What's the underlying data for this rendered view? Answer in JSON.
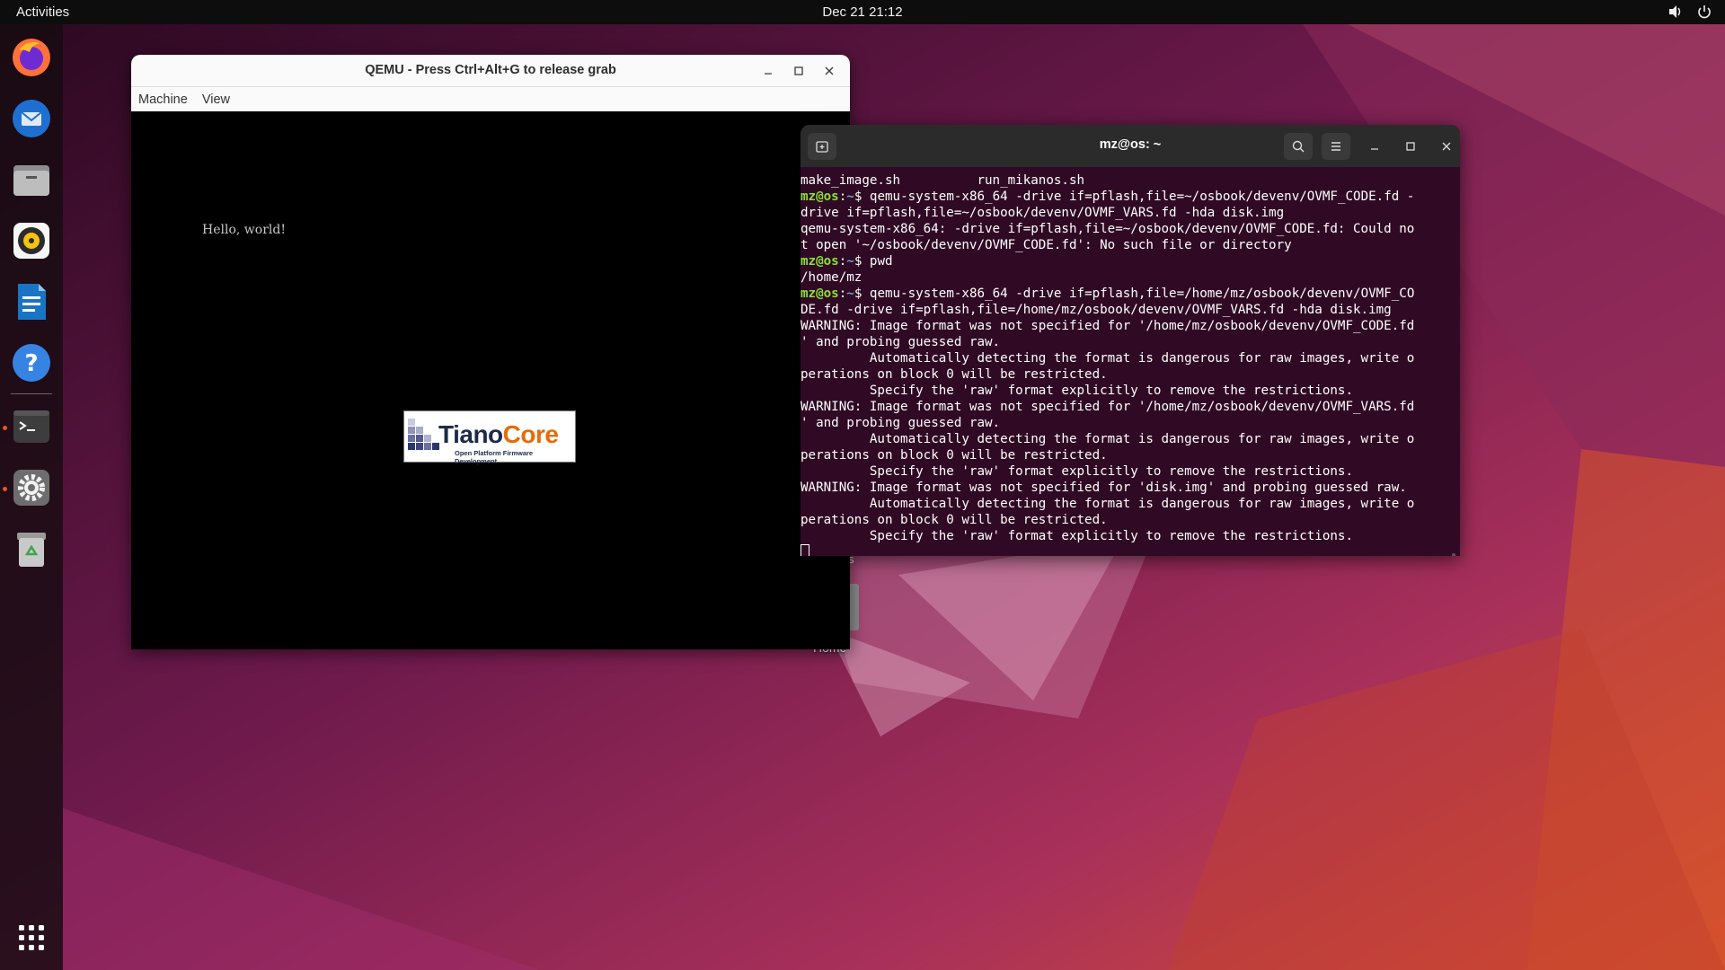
{
  "topbar": {
    "activities_label": "Activities",
    "clock": "Dec 21  21:12",
    "tray_icons": [
      "volume-icon",
      "power-icon"
    ]
  },
  "dock": {
    "apps": [
      {
        "name": "firefox-icon",
        "running": false
      },
      {
        "name": "thunderbird-icon",
        "running": false
      },
      {
        "name": "files-icon",
        "running": false
      },
      {
        "name": "rhythmbox-icon",
        "running": false
      },
      {
        "name": "libreoffice-writer-icon",
        "running": false
      },
      {
        "name": "help-icon",
        "running": false
      },
      {
        "name": "terminal-icon",
        "running": true
      },
      {
        "name": "settings-icon",
        "running": true
      },
      {
        "name": "trash-icon",
        "running": false
      }
    ],
    "show_apps_icon": "app-grid-icon",
    "accent": "#e95420"
  },
  "desktop": {
    "home_label": "Home",
    "partial_label": "s"
  },
  "qemu": {
    "title": "QEMU - Press Ctrl+Alt+G to release grab",
    "menu": [
      "Machine",
      "View"
    ],
    "screen_text": "Hello, world!",
    "logo_main": "Tiano",
    "logo_accent": "Core",
    "logo_sub": "Open Platform Firmware Development"
  },
  "terminal": {
    "title": "mz@os: ~",
    "prompt_user": "mz@os",
    "prompt_path": "~",
    "lines": [
      {
        "type": "out",
        "text": "make_image.sh          run_mikanos.sh"
      },
      {
        "type": "cmd",
        "text": "qemu-system-x86_64 -drive if=pflash,file=~/osbook/devenv/OVMF_CODE.fd -"
      },
      {
        "type": "out",
        "text": "drive if=pflash,file=~/osbook/devenv/OVMF_VARS.fd -hda disk.img"
      },
      {
        "type": "out",
        "text": "qemu-system-x86_64: -drive if=pflash,file=~/osbook/devenv/OVMF_CODE.fd: Could no"
      },
      {
        "type": "out",
        "text": "t open '~/osbook/devenv/OVMF_CODE.fd': No such file or directory"
      },
      {
        "type": "cmd",
        "text": "pwd"
      },
      {
        "type": "out",
        "text": "/home/mz"
      },
      {
        "type": "cmd",
        "text": "qemu-system-x86_64 -drive if=pflash,file=/home/mz/osbook/devenv/OVMF_CO"
      },
      {
        "type": "out",
        "text": "DE.fd -drive if=pflash,file=/home/mz/osbook/devenv/OVMF_VARS.fd -hda disk.img"
      },
      {
        "type": "out",
        "text": "WARNING: Image format was not specified for '/home/mz/osbook/devenv/OVMF_CODE.fd"
      },
      {
        "type": "out",
        "text": "' and probing guessed raw."
      },
      {
        "type": "out",
        "text": "         Automatically detecting the format is dangerous for raw images, write o"
      },
      {
        "type": "out",
        "text": "perations on block 0 will be restricted."
      },
      {
        "type": "out",
        "text": "         Specify the 'raw' format explicitly to remove the restrictions."
      },
      {
        "type": "out",
        "text": "WARNING: Image format was not specified for '/home/mz/osbook/devenv/OVMF_VARS.fd"
      },
      {
        "type": "out",
        "text": "' and probing guessed raw."
      },
      {
        "type": "out",
        "text": "         Automatically detecting the format is dangerous for raw images, write o"
      },
      {
        "type": "out",
        "text": "perations on block 0 will be restricted."
      },
      {
        "type": "out",
        "text": "         Specify the 'raw' format explicitly to remove the restrictions."
      },
      {
        "type": "out",
        "text": "WARNING: Image format was not specified for 'disk.img' and probing guessed raw."
      },
      {
        "type": "out",
        "text": "         Automatically detecting the format is dangerous for raw images, write o"
      },
      {
        "type": "out",
        "text": "perations on block 0 will be restricted."
      },
      {
        "type": "out",
        "text": "         Specify the 'raw' format explicitly to remove the restrictions."
      }
    ],
    "colors": {
      "background": "#300a24",
      "prompt_user": "#8ae234",
      "prompt_path": "#729fcf"
    }
  }
}
